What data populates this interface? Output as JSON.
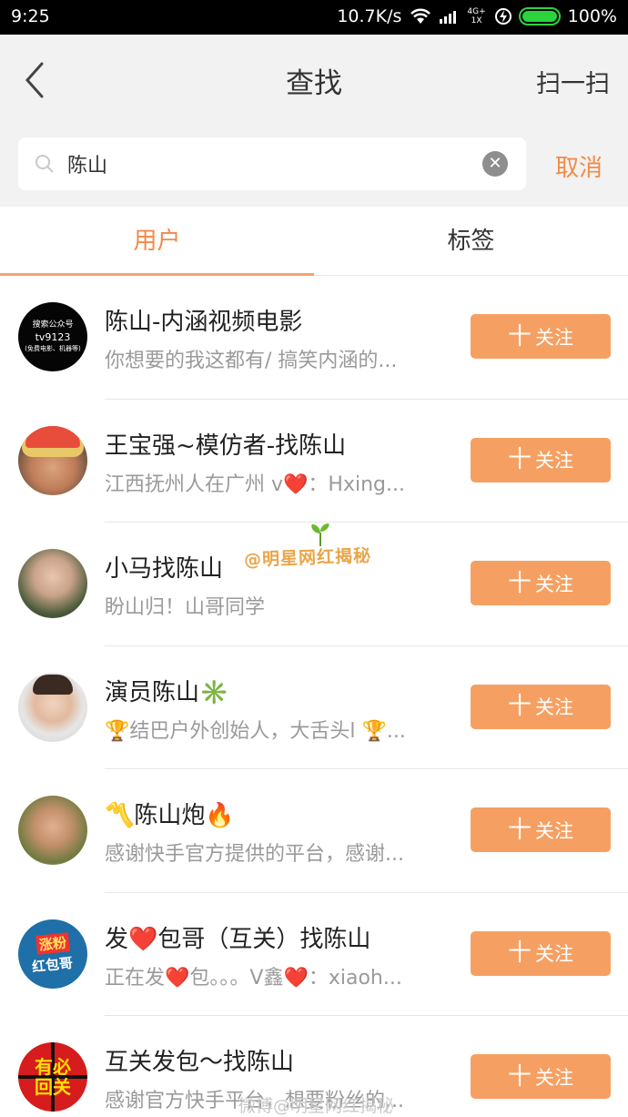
{
  "status_bar": {
    "time": "9:25",
    "speed": "10.7K/s",
    "network": "4G+",
    "network_sub": "1X",
    "battery": "100%"
  },
  "header": {
    "title": "查找",
    "scan_label": "扫一扫"
  },
  "search": {
    "value": "陈山",
    "cancel_label": "取消"
  },
  "tabs": [
    {
      "label": "用户",
      "active": true
    },
    {
      "label": "标签",
      "active": false
    }
  ],
  "results": [
    {
      "name": "陈山-内涵视频电影",
      "desc": "你想要的我这都有/ 搞笑内涵的...",
      "follow_label": "关注",
      "avatar_text": [
        "搜索公众号",
        "tv9123",
        "(免费电影、机器等)"
      ]
    },
    {
      "name": "王宝强~模仿者-找陈山",
      "desc": "江西抚州人在广州 v❤️：Hxing...",
      "follow_label": "关注"
    },
    {
      "name": "小马找陈山",
      "desc": "盼山归！山哥同学",
      "follow_label": "关注"
    },
    {
      "name": "演员陈山✳️",
      "desc": "🏆结巴户外创始人，大舌头l 🏆...",
      "follow_label": "关注"
    },
    {
      "name": "〽️陈山炮🔥",
      "desc": "感谢快手官方提供的平台，感谢...",
      "follow_label": "关注"
    },
    {
      "name": "发❤️包哥（互关）找陈山",
      "desc": "正在发❤️包。。。V鑫❤️：xiaoh...",
      "follow_label": "关注",
      "avatar_text": [
        "涨粉",
        "红包哥"
      ]
    },
    {
      "name": "互关发包～找陈山",
      "desc": "感谢官方快手平台，想要粉丝的...",
      "follow_label": "关注",
      "avatar_text": [
        "有必",
        "回关"
      ]
    }
  ],
  "watermark": "@明星网红揭秘",
  "footer_watermark": "微博@明星网红揭秘",
  "colors": {
    "accent": "#f28a45",
    "follow_button": "#f5a062",
    "header_bg": "#f2f2f2",
    "battery": "#2bd43c"
  }
}
